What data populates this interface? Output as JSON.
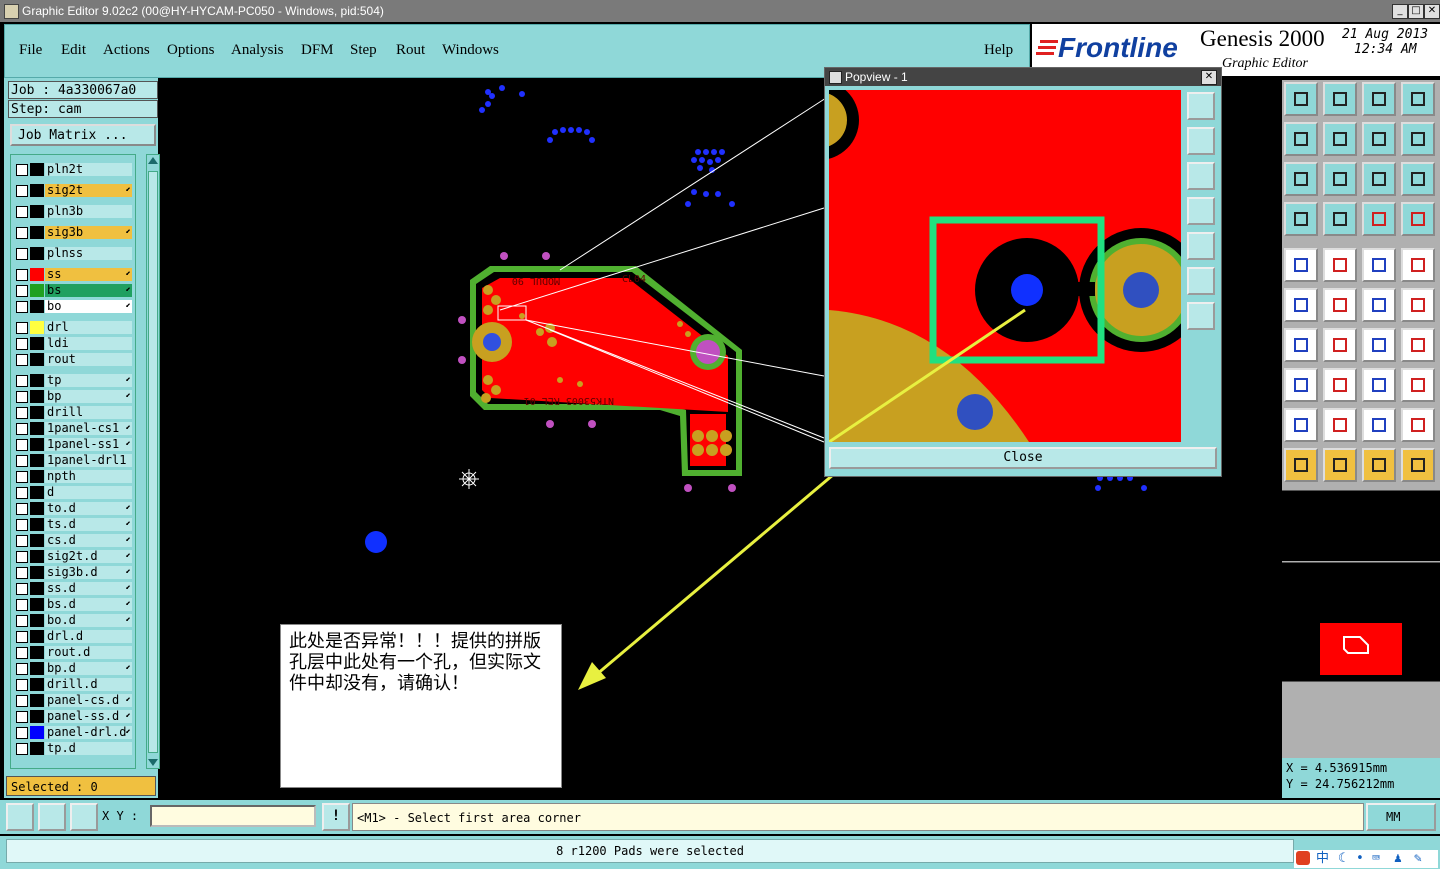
{
  "window": {
    "title": "Graphic Editor 9.02c2 (00@HY-HYCAM-PC050 - Windows, pid:504)",
    "minimize": "_",
    "maximize": "□",
    "close": "✕"
  },
  "menu": {
    "items": [
      "File",
      "Edit",
      "Actions",
      "Options",
      "Analysis",
      "DFM",
      "Step",
      "Rout",
      "Windows"
    ],
    "help": "Help"
  },
  "brand": {
    "logo": "Frontline",
    "product": "Genesis 2000",
    "subtitle": "Graphic Editor",
    "date": "21 Aug 2013",
    "time": "12:34 AM"
  },
  "job": {
    "job_line": "Job  : 4a330067a0",
    "step_line": "Step: cam",
    "matrix_button": "Job Matrix ..."
  },
  "layers": [
    {
      "name": "pln2t",
      "color": "#000000",
      "marker": ""
    },
    {
      "name": "sig2t",
      "color": "#000000",
      "marker": "⬋",
      "highlight": "#f0c040"
    },
    {
      "name": "pln3b",
      "color": "#000000",
      "marker": ""
    },
    {
      "name": "sig3b",
      "color": "#000000",
      "marker": "⬋",
      "highlight": "#f0c040"
    },
    {
      "name": "plnss",
      "color": "#000000",
      "marker": ""
    },
    {
      "name": "ss",
      "color": "#ff0000",
      "marker": "⬋",
      "highlight": "#f0c040"
    },
    {
      "name": "bs",
      "color": "#20a020",
      "marker": "⬋",
      "highlight": "#20a060"
    },
    {
      "name": "bo",
      "color": "#000000",
      "marker": "⬋",
      "highlight": "#ffffff"
    },
    {
      "name": "drl",
      "color": "#ffff40",
      "marker": ""
    },
    {
      "name": "ldi",
      "color": "#000000",
      "marker": ""
    },
    {
      "name": "rout",
      "color": "#000000",
      "marker": ""
    },
    {
      "name": "tp",
      "color": "#000000",
      "marker": "⬋"
    },
    {
      "name": "bp",
      "color": "#000000",
      "marker": "⬋"
    },
    {
      "name": "drill",
      "color": "#000000",
      "marker": ""
    },
    {
      "name": "1panel-cs1",
      "color": "#000000",
      "marker": "⬋"
    },
    {
      "name": "1panel-ss1",
      "color": "#000000",
      "marker": "⬋"
    },
    {
      "name": "1panel-drl1",
      "color": "#000000",
      "marker": ""
    },
    {
      "name": "npth",
      "color": "#000000",
      "marker": ""
    },
    {
      "name": "d",
      "color": "#000000",
      "marker": ""
    },
    {
      "name": "to.d",
      "color": "#000000",
      "marker": "⬋"
    },
    {
      "name": "ts.d",
      "color": "#000000",
      "marker": "⬋"
    },
    {
      "name": "cs.d",
      "color": "#000000",
      "marker": "⬋"
    },
    {
      "name": "sig2t.d",
      "color": "#000000",
      "marker": "⬋"
    },
    {
      "name": "sig3b.d",
      "color": "#000000",
      "marker": "⬋"
    },
    {
      "name": "ss.d",
      "color": "#000000",
      "marker": "⬋"
    },
    {
      "name": "bs.d",
      "color": "#000000",
      "marker": "⬋"
    },
    {
      "name": "bo.d",
      "color": "#000000",
      "marker": "⬋"
    },
    {
      "name": "drl.d",
      "color": "#000000",
      "marker": ""
    },
    {
      "name": "rout.d",
      "color": "#000000",
      "marker": ""
    },
    {
      "name": "bp.d",
      "color": "#000000",
      "marker": "⬋"
    },
    {
      "name": "drill.d",
      "color": "#000000",
      "marker": ""
    },
    {
      "name": "panel-cs.d",
      "color": "#000000",
      "marker": "⬋"
    },
    {
      "name": "panel-ss.d",
      "color": "#000000",
      "marker": "⬋"
    },
    {
      "name": "panel-drl.d",
      "color": "#0000ff",
      "marker": "⬋"
    },
    {
      "name": "tp.d",
      "color": "#000000",
      "marker": ""
    }
  ],
  "selected": "Selected : 0",
  "popview": {
    "title": "Popview - 1",
    "close": "Close"
  },
  "board_text": {
    "top_text": "MODUL 90",
    "top_right": "CL04",
    "bottom_text": "NTK53003 REL 01"
  },
  "note": {
    "text": "此处是否异常！！！提供的拼版孔层中此处有一个孔，但实际文件中却没有，请确认！"
  },
  "coords": {
    "x": "X  =  4.536915mm",
    "y": "Y  =  24.756212mm"
  },
  "bottom": {
    "xy_label": "X Y :",
    "prompt": "<M1> - Select first area corner",
    "units": "MM"
  },
  "status": {
    "message": "8 r1200 Pads were selected"
  },
  "tray": {
    "lang": "中"
  }
}
